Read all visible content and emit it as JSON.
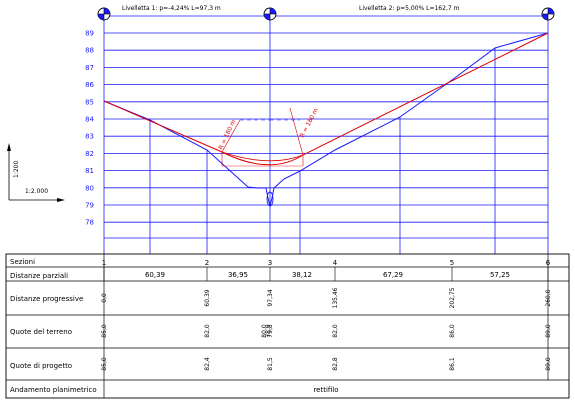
{
  "header": {
    "grade_1": "Livelletta 1: p=-4,24% L=97,3 m",
    "grade_2": "Livelletta 2: p=5,00% L=162,7 m"
  },
  "y_axis": {
    "ticks": [
      "89",
      "88",
      "87",
      "86",
      "85",
      "84",
      "83",
      "82",
      "81",
      "80",
      "79",
      "78"
    ]
  },
  "scale": {
    "vertical": "1:200",
    "horizontal": "1:2.000"
  },
  "curves": {
    "left_radius": "R = 180 m",
    "right_radius": "R = 180 m"
  },
  "table": {
    "row_labels": {
      "sections": "Sezioni",
      "partial": "Distanze parziali",
      "progressive": "Distanze progressive",
      "ground": "Quote del terreno",
      "project": "Quote di progetto",
      "alignment": "Andamento planimetrico"
    },
    "sections": [
      "1",
      "2",
      "3",
      "4",
      "5",
      "6"
    ],
    "partial": [
      "60,39",
      "36,95",
      "38,12",
      "67,29",
      "57,25"
    ],
    "progressive": [
      "0,0",
      "60,39",
      "97,34",
      "135,46",
      "202,75",
      "260,0"
    ],
    "ground": [
      "85,0",
      "82,0",
      "79,8",
      "82,0",
      "86,0",
      "89,0"
    ],
    "ground_extra": [
      "80,0",
      "78,9"
    ],
    "project": [
      "85,0",
      "82,4",
      "81,5",
      "82,8",
      "86,1",
      "89,0"
    ],
    "alignment": "rettifilo"
  },
  "colors": {
    "grid": "#1a1aff",
    "ground": "#1a1aff",
    "project": "#e00000",
    "marker": "#1a1aff"
  }
}
